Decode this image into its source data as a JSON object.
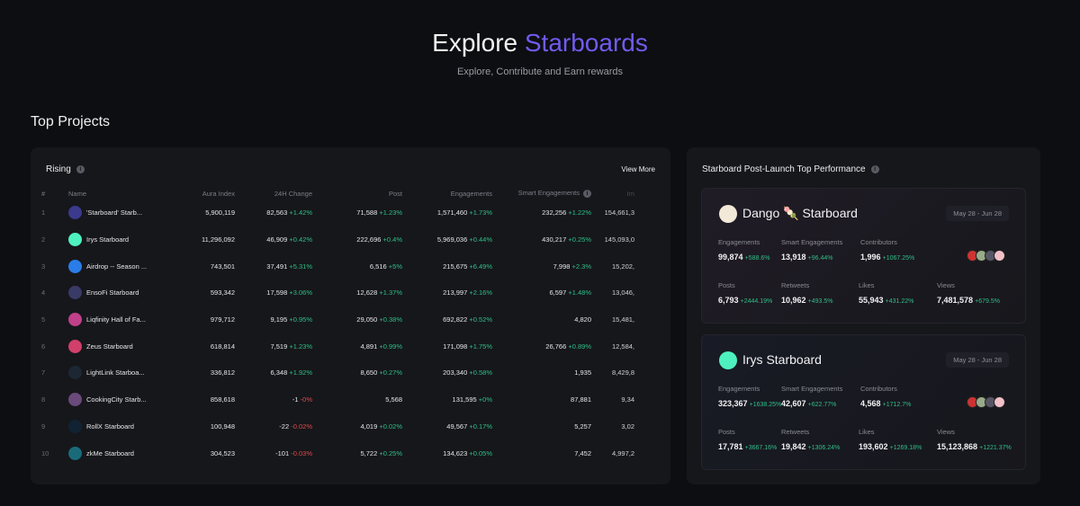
{
  "hero": {
    "title_a": "Explore",
    "title_b": "Starboards",
    "subtitle": "Explore, Contribute and Earn rewards"
  },
  "section_title": "Top Projects",
  "rising": {
    "title": "Rising",
    "view_more": "View More",
    "columns": [
      "#",
      "Name",
      "Aura Index",
      "24H Change",
      "Post",
      "Engagements",
      "Smart Engagements",
      "Im"
    ],
    "rows": [
      {
        "rank": "1",
        "name": "'Starboard' Starb...",
        "aura": "5,900,119",
        "ch": "82,563",
        "chp": "+1.42%",
        "post": "71,588",
        "postp": "+1.23%",
        "eng": "1,571,460",
        "engp": "+1.73%",
        "smart": "232,256",
        "smartp": "+1.22%",
        "imp": "154,661,3",
        "color": "#3b3a8c"
      },
      {
        "rank": "2",
        "name": "Irys Starboard",
        "aura": "11,296,092",
        "ch": "46,909",
        "chp": "+0.42%",
        "post": "222,696",
        "postp": "+0.4%",
        "eng": "5,969,036",
        "engp": "+0.44%",
        "smart": "430,217",
        "smartp": "+0.25%",
        "imp": "145,093,0",
        "color": "#4ff0c0"
      },
      {
        "rank": "3",
        "name": "Airdrop -- Season ...",
        "aura": "743,501",
        "ch": "37,491",
        "chp": "+5.31%",
        "post": "6,516",
        "postp": "+5%",
        "eng": "215,675",
        "engp": "+6.49%",
        "smart": "7,998",
        "smartp": "+2.3%",
        "imp": "15,202,",
        "color": "#2a7de8"
      },
      {
        "rank": "4",
        "name": "EnsoFi Starboard",
        "aura": "593,342",
        "ch": "17,598",
        "chp": "+3.06%",
        "post": "12,628",
        "postp": "+1.37%",
        "eng": "213,997",
        "engp": "+2.16%",
        "smart": "6,597",
        "smartp": "+1.48%",
        "imp": "13,046,",
        "color": "#3a3a66"
      },
      {
        "rank": "5",
        "name": "Liqfinity Hall of Fa...",
        "aura": "979,712",
        "ch": "9,195",
        "chp": "+0.95%",
        "post": "29,050",
        "postp": "+0.38%",
        "eng": "692,822",
        "engp": "+0.52%",
        "smart": "4,820",
        "smartp": "",
        "imp": "15,481,",
        "color": "#c0408a"
      },
      {
        "rank": "6",
        "name": "Zeus Starboard",
        "aura": "618,814",
        "ch": "7,519",
        "chp": "+1.23%",
        "post": "4,891",
        "postp": "+0.99%",
        "eng": "171,098",
        "engp": "+1.75%",
        "smart": "26,766",
        "smartp": "+0.89%",
        "imp": "12,584,",
        "color": "#d0406a"
      },
      {
        "rank": "7",
        "name": "LightLink Starboa...",
        "aura": "336,812",
        "ch": "6,348",
        "chp": "+1.92%",
        "post": "8,650",
        "postp": "+0.27%",
        "eng": "203,340",
        "engp": "+0.58%",
        "smart": "1,935",
        "smartp": "",
        "imp": "8,429,8",
        "color": "#1c2733"
      },
      {
        "rank": "8",
        "name": "CookingCity Starb...",
        "aura": "858,618",
        "ch": "-1",
        "chp": "-0%",
        "post": "5,568",
        "postp": "",
        "eng": "131,595",
        "engp": "+0%",
        "smart": "87,881",
        "smartp": "",
        "imp": "9,34",
        "color": "#6a4a7a"
      },
      {
        "rank": "9",
        "name": "RollX Starboard",
        "aura": "100,948",
        "ch": "-22",
        "chp": "-0.02%",
        "post": "4,019",
        "postp": "+0.02%",
        "eng": "49,567",
        "engp": "+0.17%",
        "smart": "5,257",
        "smartp": "",
        "imp": "3,02",
        "color": "#123"
      },
      {
        "rank": "10",
        "name": "zkMe Starboard",
        "aura": "304,523",
        "ch": "-101",
        "chp": "-0.03%",
        "post": "5,722",
        "postp": "+0.25%",
        "eng": "134,623",
        "engp": "+0.05%",
        "smart": "7,452",
        "smartp": "",
        "imp": "4,997,2",
        "color": "#1a6b7a"
      }
    ]
  },
  "performance": {
    "title": "Starboard Post-Launch Top Performance",
    "cards": [
      {
        "name": "Dango 🍡 Starboard",
        "date": "May 28 - Jun 28",
        "logo_color": "#f3e9d8",
        "stats": [
          [
            "Engagements",
            "99,874",
            "+588.6%"
          ],
          [
            "Smart Engagements",
            "13,918",
            "+96.44%"
          ],
          [
            "Contributors",
            "1,996",
            "+1067.25%"
          ],
          [
            "Posts",
            "6,793",
            "+2444.19%"
          ],
          [
            "Retweets",
            "10,962",
            "+493.5%"
          ],
          [
            "Likes",
            "55,943",
            "+431.22%"
          ],
          [
            "Views",
            "7,481,578",
            "+679.5%"
          ]
        ]
      },
      {
        "name": "Irys Starboard",
        "date": "May 28 - Jun 28",
        "logo_color": "#4ff0c0",
        "stats": [
          [
            "Engagements",
            "323,367",
            "+1638.25%"
          ],
          [
            "Smart Engagements",
            "42,607",
            "+622.77%"
          ],
          [
            "Contributors",
            "4,568",
            "+1712.7%"
          ],
          [
            "Posts",
            "17,781",
            "+3667.16%"
          ],
          [
            "Retweets",
            "19,842",
            "+1306.24%"
          ],
          [
            "Likes",
            "193,602",
            "+1269.18%"
          ],
          [
            "Views",
            "15,123,868",
            "+1221.37%"
          ]
        ]
      }
    ]
  }
}
